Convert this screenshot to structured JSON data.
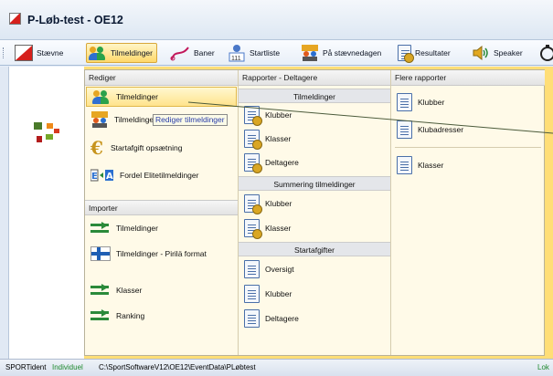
{
  "window": {
    "title": "P-Løb-test  -  OE12"
  },
  "menubar": {
    "items": [
      {
        "label": "Stævne",
        "icon": "orienteering-flag-icon"
      },
      {
        "label": "Tilmeldinger",
        "icon": "people-icon",
        "active": true
      },
      {
        "label": "Baner",
        "icon": "course-icon"
      },
      {
        "label": "Startliste",
        "icon": "start-clock-icon"
      },
      {
        "label": "På stævnedagen",
        "icon": "people-sign-icon"
      },
      {
        "label": "Resultater",
        "icon": "results-document-icon"
      },
      {
        "label": "Speaker",
        "icon": "speaker-icon"
      }
    ]
  },
  "dropdown": {
    "rediger": {
      "header": "Rediger",
      "items": [
        {
          "label": "Tilmeldinger",
          "icon": "people-icon",
          "highlighted": true
        },
        {
          "label": "Tilmeldinger på dagen",
          "icon": "people-sign-icon"
        },
        {
          "label": "Startafgift opsætning",
          "icon": "euro-icon"
        },
        {
          "label": "Fordel Elitetilmeldinger",
          "icon": "e-to-a-icon"
        }
      ]
    },
    "importer": {
      "header": "Importer",
      "items": [
        {
          "label": "Tilmeldinger",
          "icon": "import-arrow-icon"
        },
        {
          "label": "Tilmeldinger - Pirilä format",
          "icon": "finnish-flag-icon"
        },
        {
          "label": "Klasser",
          "icon": "import-arrow-icon"
        },
        {
          "label": "Ranking",
          "icon": "import-arrow-icon"
        }
      ]
    },
    "rapporter": {
      "header": "Rapporter - Deltagere",
      "groups": [
        {
          "title": "Tilmeldinger",
          "items": [
            "Klubber",
            "Klasser",
            "Deltagere"
          ]
        },
        {
          "title": "Summering tilmeldinger",
          "items": [
            "Klubber",
            "Klasser"
          ]
        },
        {
          "title": "Startafgifter",
          "items": [
            "Oversigt",
            "Klubber",
            "Deltagere"
          ]
        }
      ]
    },
    "flere": {
      "header": "Flere rapporter",
      "items": [
        "Klubber",
        "Klubadresser",
        "Klasser"
      ]
    }
  },
  "tooltip": "Rediger tilmeldinger",
  "statusbar": {
    "app": "SPORTident",
    "mode": "Individuel",
    "path": "C:\\SportSoftwareV12\\OE12\\EventData\\PLøbtest",
    "right": "Lok"
  },
  "colors": {
    "accent": "#ffde77",
    "menu_bg": "#fffae8",
    "mode_green": "#1f8a2e"
  }
}
